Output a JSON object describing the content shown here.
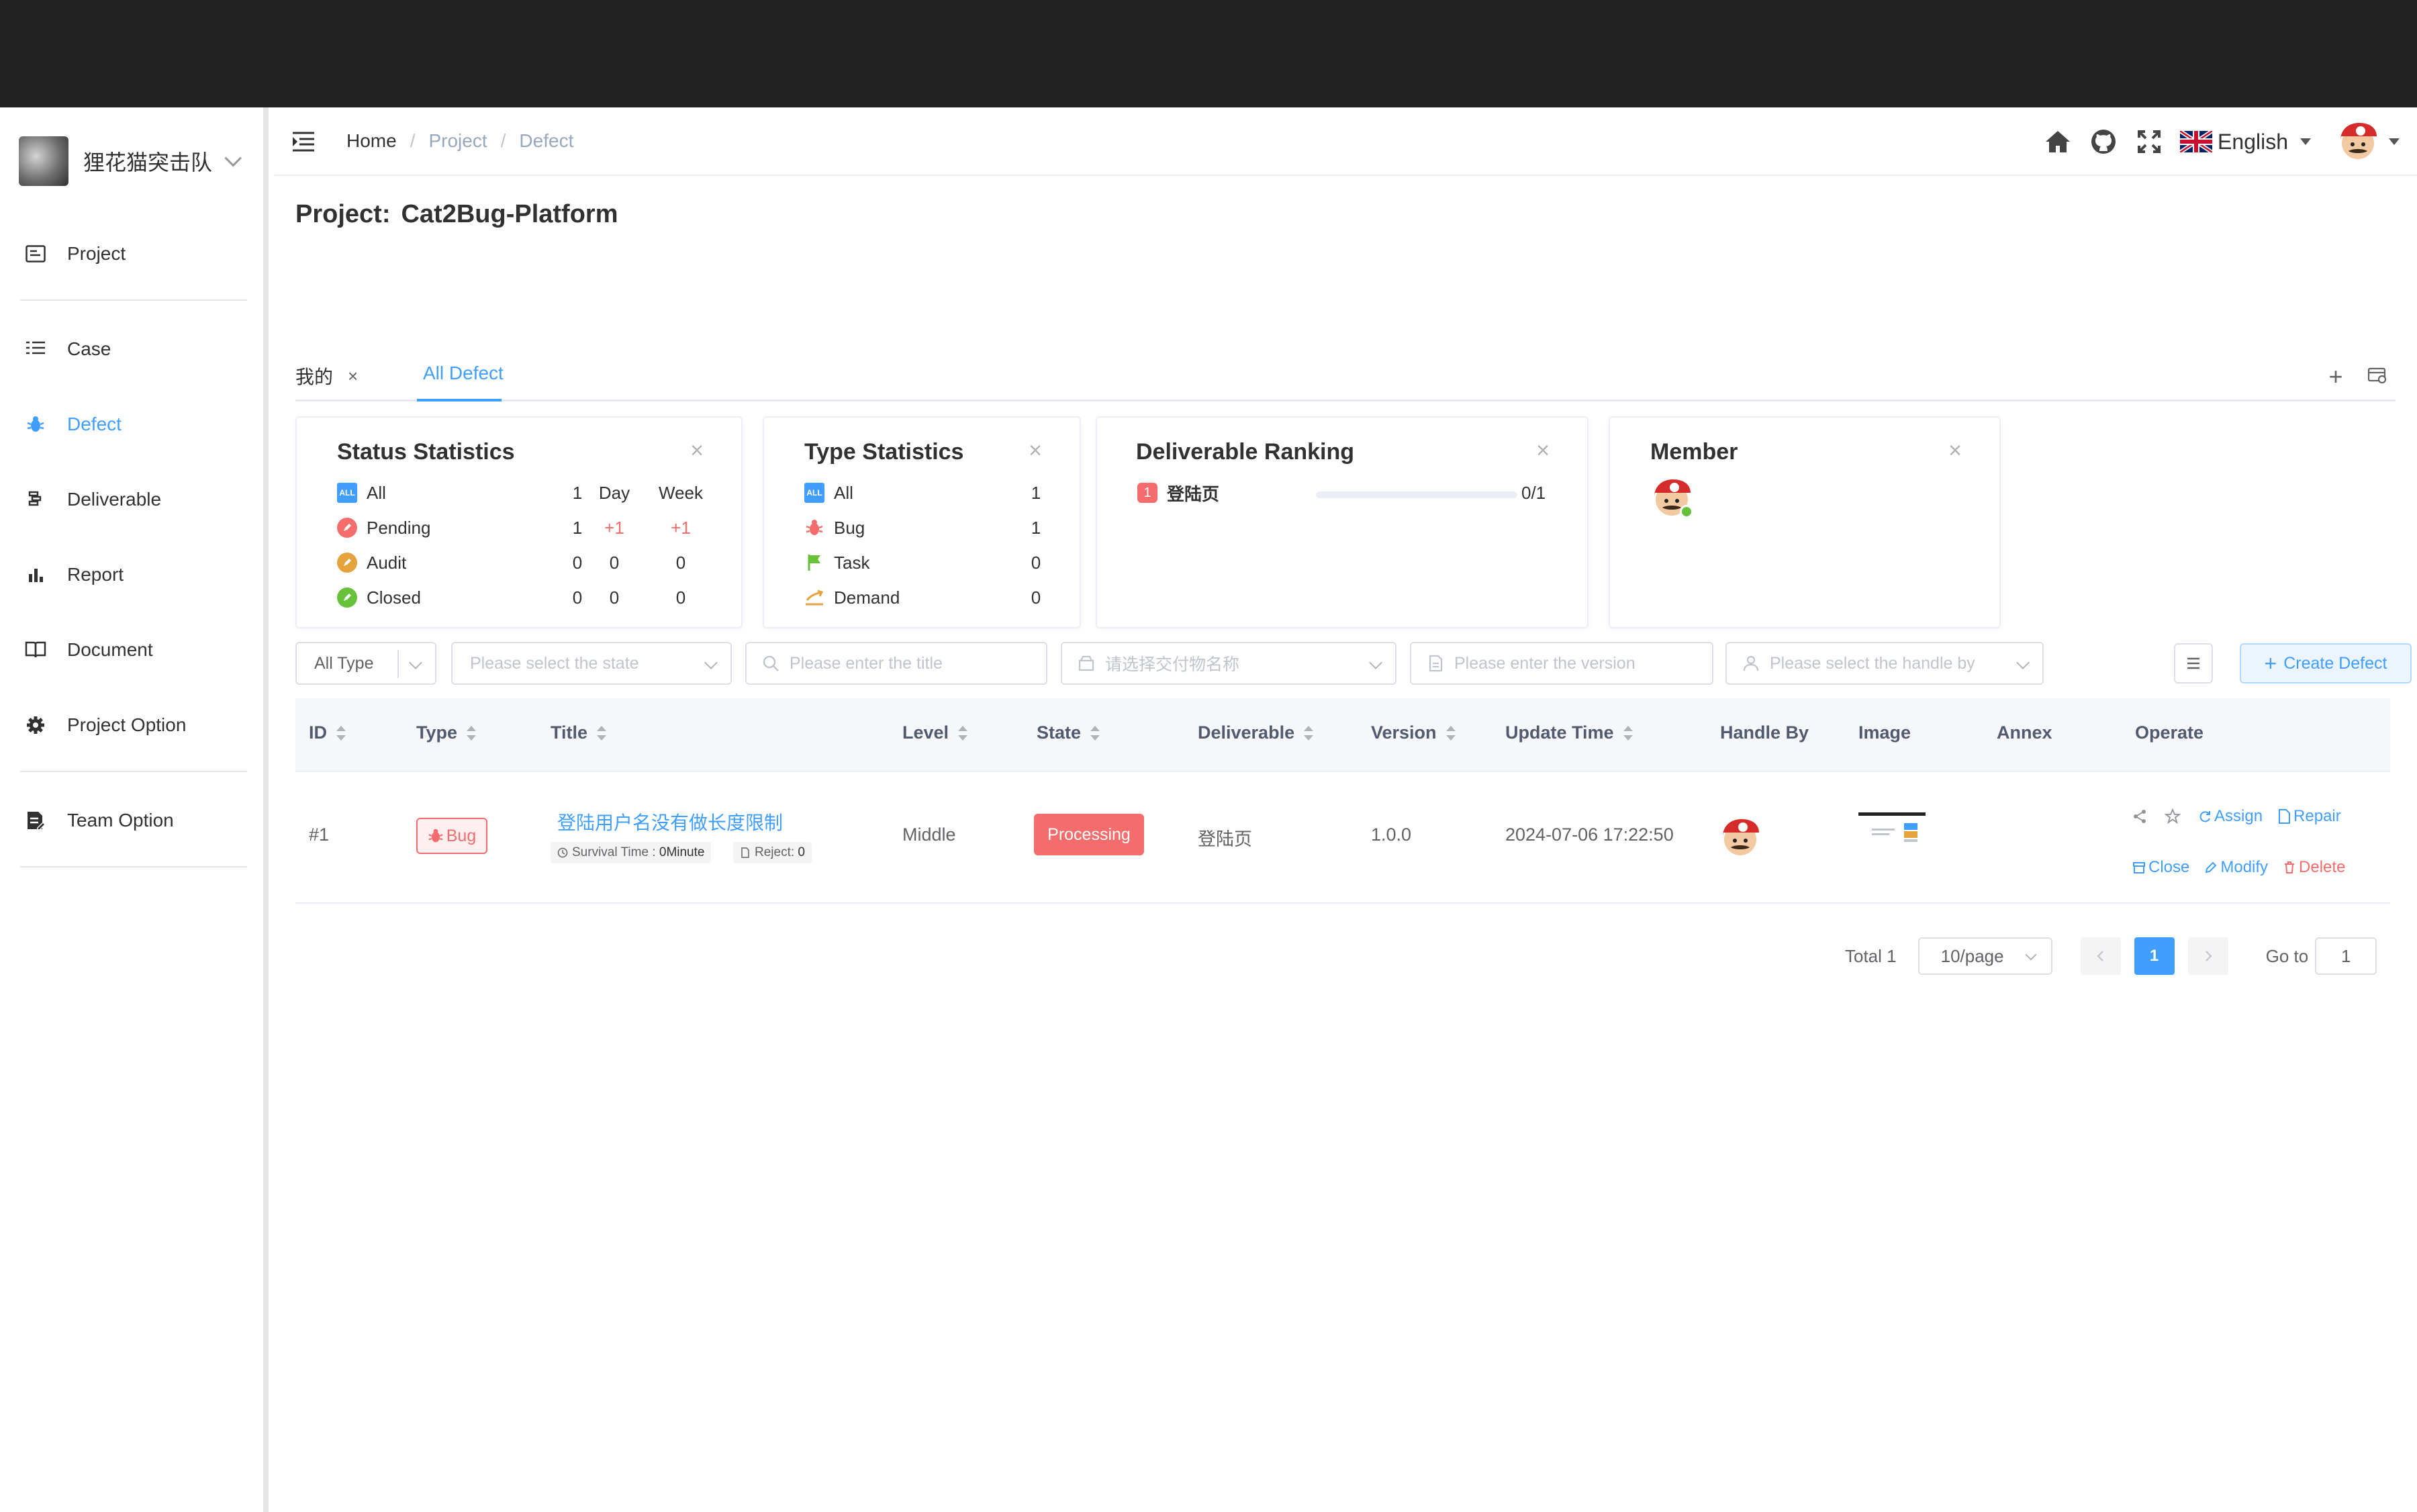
{
  "team": {
    "name": "狸花猫突击队"
  },
  "nav": {
    "items": [
      {
        "label": "Project",
        "icon": "project-icon"
      },
      {
        "label": "Case",
        "icon": "case-list-icon"
      },
      {
        "label": "Defect",
        "icon": "bug-icon",
        "active": true
      },
      {
        "label": "Deliverable",
        "icon": "deliverable-icon"
      },
      {
        "label": "Report",
        "icon": "bar-chart-icon"
      },
      {
        "label": "Document",
        "icon": "book-icon"
      },
      {
        "label": "Project Option",
        "icon": "gear-icon"
      },
      {
        "label": "Team Option",
        "icon": "team-option-icon"
      }
    ]
  },
  "header": {
    "breadcrumb": [
      "Home",
      "Project",
      "Defect"
    ],
    "separator": "/",
    "language": "English"
  },
  "project": {
    "label": "Project:",
    "name": "Cat2Bug-Platform"
  },
  "tabs": [
    {
      "label": "我的",
      "closable": true,
      "close": "×"
    },
    {
      "label": "All Defect",
      "active": true
    }
  ],
  "tab_tools": {
    "add": "+"
  },
  "status_stats": {
    "title": "Status Statistics",
    "close": "×",
    "col_day": "Day",
    "col_week": "Week",
    "all_icon_text": "ALL",
    "rows": [
      {
        "label": "All",
        "count": "1",
        "day": "",
        "week": ""
      },
      {
        "label": "Pending",
        "count": "1",
        "day": "+1",
        "week": "+1"
      },
      {
        "label": "Audit",
        "count": "0",
        "day": "0",
        "week": "0"
      },
      {
        "label": "Closed",
        "count": "0",
        "day": "0",
        "week": "0"
      }
    ]
  },
  "type_stats": {
    "title": "Type Statistics",
    "close": "×",
    "rows": [
      {
        "label": "All",
        "count": "1"
      },
      {
        "label": "Bug",
        "count": "1"
      },
      {
        "label": "Task",
        "count": "0"
      },
      {
        "label": "Demand",
        "count": "0"
      }
    ]
  },
  "deliverable_ranking": {
    "title": "Deliverable Ranking",
    "close": "×",
    "rank": "1",
    "name": "登陆页",
    "progress": 0,
    "count": "0/1"
  },
  "member_card": {
    "title": "Member",
    "close": "×"
  },
  "filters": {
    "type": "All Type",
    "state_placeholder": "Please select the state",
    "title_placeholder": "Please enter the title",
    "deliverable_placeholder": "请选择交付物名称",
    "version_placeholder": "Please enter the version",
    "handler_placeholder": "Please select the handle by",
    "create_label": "Create Defect",
    "create_plus": "+"
  },
  "table": {
    "columns": [
      "ID",
      "Type",
      "Title",
      "Level",
      "State",
      "Deliverable",
      "Version",
      "Update Time",
      "Handle By",
      "Image",
      "Annex",
      "Operate"
    ],
    "rows": [
      {
        "id": "#1",
        "type": "Bug",
        "title": "登陆用户名没有做长度限制",
        "survival_label": "Survival Time :",
        "survival_value": "0Minute",
        "reject_label": "Reject:",
        "reject_value": "0",
        "level": "Middle",
        "state": "Processing",
        "deliverable": "登陆页",
        "version": "1.0.0",
        "update_time": "2024-07-06 17:22:50",
        "ops": {
          "assign": "Assign",
          "repair": "Repair",
          "close": "Close",
          "modify": "Modify",
          "delete": "Delete"
        }
      }
    ]
  },
  "pagination": {
    "total": "Total 1",
    "page_size": "10/page",
    "current": "1",
    "goto_label": "Go to",
    "goto_value": "1"
  },
  "colors": {
    "accent": "#409eff",
    "danger": "#f56c6c",
    "success": "#67c23a",
    "warning": "#e6a23c",
    "topbar": "#222222"
  }
}
